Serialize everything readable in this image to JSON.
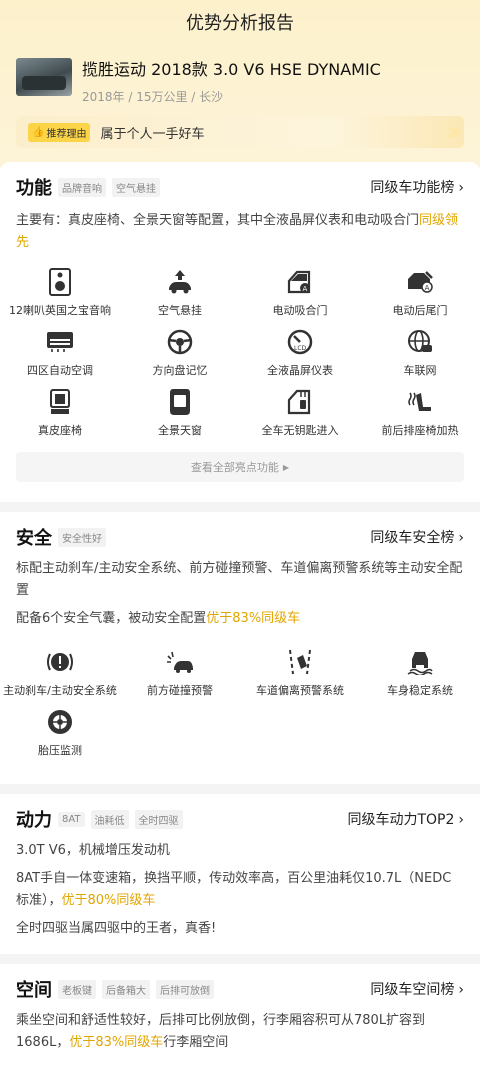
{
  "header": {
    "title": "优势分析报告"
  },
  "car": {
    "name": "揽胜运动 2018款 3.0 V6 HSE DYNAMIC",
    "meta": "2018年 / 15万公里 / 长沙"
  },
  "reason": {
    "tag": "推荐理由",
    "text": "属于个人一手好车"
  },
  "function": {
    "title": "功能",
    "chips": [
      "品牌音响",
      "空气悬挂"
    ],
    "rank": "同级车功能榜",
    "desc": "主要有：真皮座椅、全景天窗等配置，其中全液晶屏仪表和电动吸合门",
    "desc_hl": "同级领先",
    "items": [
      {
        "label": "12喇叭英国之宝音响",
        "icon": "speaker-icon"
      },
      {
        "label": "空气悬挂",
        "icon": "air-suspension-icon"
      },
      {
        "label": "电动吸合门",
        "icon": "soft-close-door-icon"
      },
      {
        "label": "电动后尾门",
        "icon": "power-tailgate-icon"
      },
      {
        "label": "四区自动空调",
        "icon": "climate-control-icon"
      },
      {
        "label": "方向盘记忆",
        "icon": "steering-wheel-icon"
      },
      {
        "label": "全液晶屏仪表",
        "icon": "lcd-dashboard-icon"
      },
      {
        "label": "车联网",
        "icon": "connected-car-icon"
      },
      {
        "label": "真皮座椅",
        "icon": "leather-seat-icon"
      },
      {
        "label": "全景天窗",
        "icon": "sunroof-icon"
      },
      {
        "label": "全车无钥匙进入",
        "icon": "keyless-entry-icon"
      },
      {
        "label": "前后排座椅加热",
        "icon": "seat-heating-icon"
      }
    ],
    "view_all": "查看全部亮点功能"
  },
  "safety": {
    "title": "安全",
    "chips": [
      "安全性好"
    ],
    "rank": "同级车安全榜",
    "desc1": "标配主动刹车/主动安全系统、前方碰撞预警、车道偏离预警系统等主动安全配置",
    "desc2": "配备6个安全气囊，被动安全配置",
    "desc2_hl": "优于83%同级车",
    "items": [
      {
        "label": "主动刹车/主动安全系统",
        "icon": "active-brake-icon"
      },
      {
        "label": "前方碰撞预警",
        "icon": "collision-warning-icon"
      },
      {
        "label": "车道偏离预警系统",
        "icon": "lane-departure-icon"
      },
      {
        "label": "车身稳定系统",
        "icon": "stability-control-icon"
      },
      {
        "label": "胎压监测",
        "icon": "tire-pressure-icon"
      }
    ]
  },
  "power": {
    "title": "动力",
    "chips": [
      "8AT",
      "油耗低",
      "全时四驱"
    ],
    "rank": "同级车动力TOP2",
    "line1": "3.0T V6，机械增压发动机",
    "line2": "8AT手自一体变速箱，换挡平顺，传动效率高，百公里油耗仅10.7L（NEDC标准），",
    "line2_hl": "优于80%同级车",
    "line3": "全时四驱当属四驱中的王者，真香!"
  },
  "space": {
    "title": "空间",
    "chips": [
      "老板键",
      "后备箱大",
      "后排可放倒"
    ],
    "rank": "同级车空间榜",
    "desc": "乘坐空间和舒适性较好，后排可比例放倒，行李厢容积可从780L扩容到1686L，",
    "desc_hl": "优于83%同级车",
    "desc_tail": "行李厢空间"
  },
  "colors": {
    "accent": "#e0a600",
    "tag_yellow": "#fbd447"
  }
}
